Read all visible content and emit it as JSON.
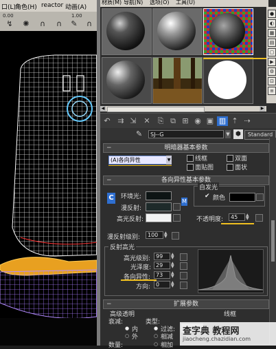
{
  "viewport_menu": {
    "items": [
      "口(L)",
      "角色(H)",
      "reactor",
      "动画(A)"
    ]
  },
  "viewport_toolbar": {
    "values": [
      "0.00",
      "1.00"
    ]
  },
  "material_menu": {
    "items": [
      "材质(M)",
      "导航(N)",
      "选项(O)",
      "工具(U)"
    ]
  },
  "material_name": {
    "value": "SJ--G",
    "type_label": "Standard"
  },
  "shader_basic": {
    "title": "明暗器基本参数",
    "shader_value": "(A)各向异性",
    "wire_label": "线框",
    "two_sided_label": "双面",
    "face_map_label": "面贴图",
    "faceted_label": "面状"
  },
  "aniso_basic": {
    "title": "各向异性基本参数",
    "ambient_label": "环境光:",
    "diffuse_label": "漫反射:",
    "specular_label": "高光反射:",
    "self_illum_label": "自发光",
    "color_label": "颜色",
    "opacity_label": "不透明度:",
    "opacity_value": "45",
    "diffuse_level_label": "漫反射级别:",
    "diffuse_level_value": "100",
    "lock_letter": "C",
    "map_letter": "M"
  },
  "spec_highlight": {
    "title": "反射高光",
    "spec_level_label": "高光级别:",
    "spec_level_value": "99",
    "gloss_label": "光泽度:",
    "gloss_value": "29",
    "aniso_label": "各向异性:",
    "aniso_value": "73",
    "orient_label": "方向:",
    "orient_value": "0"
  },
  "extended": {
    "title": "扩展参数",
    "adv_transparency": "高级透明",
    "wire": "线框",
    "falloff": "衰减:",
    "type": "类型:",
    "in": "内",
    "out": "外",
    "filter": "过滤:",
    "subtractive": "相减",
    "additive": "相加",
    "amount": "数量:"
  },
  "watermark": {
    "line1": "查字典 教程网",
    "line2": "jiaocheng.chazidian.com"
  },
  "colors": {
    "yellow_highlight": "#f0c020",
    "shader_field": "#e8e8ff",
    "accent_blue": "#2f6fd0"
  }
}
